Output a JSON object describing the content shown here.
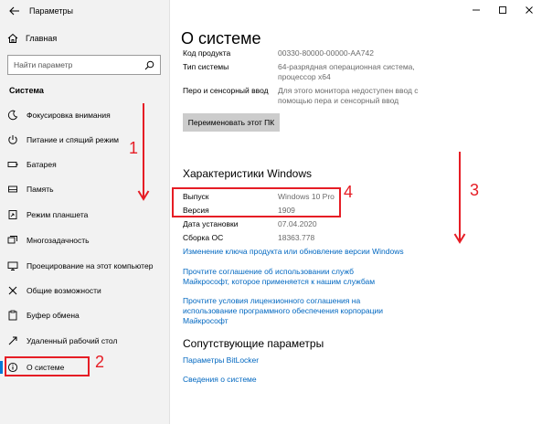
{
  "window": {
    "title": "Параметры"
  },
  "sidebar": {
    "home_label": "Главная",
    "search_placeholder": "Найти параметр",
    "section_title": "Система",
    "items": [
      {
        "label": "Фокусировка внимания",
        "icon": "moon-icon"
      },
      {
        "label": "Питание и спящий режим",
        "icon": "power-icon"
      },
      {
        "label": "Батарея",
        "icon": "battery-icon"
      },
      {
        "label": "Память",
        "icon": "storage-icon"
      },
      {
        "label": "Режим планшета",
        "icon": "tablet-icon"
      },
      {
        "label": "Многозадачность",
        "icon": "multitasking-icon"
      },
      {
        "label": "Проецирование на этот компьютер",
        "icon": "projection-icon"
      },
      {
        "label": "Общие возможности",
        "icon": "shared-icon"
      },
      {
        "label": "Буфер обмена",
        "icon": "clipboard-icon"
      },
      {
        "label": "Удаленный рабочий стол",
        "icon": "remote-icon"
      },
      {
        "label": "О системе",
        "icon": "info-icon",
        "active": true
      }
    ]
  },
  "main": {
    "page_title": "О системе",
    "device_specs": [
      {
        "label": "Код продукта",
        "value": "00330-80000-00000-AA742"
      },
      {
        "label": "Тип системы",
        "value": "64-разрядная операционная система, процессор x64"
      },
      {
        "label": "Перо и сенсорный ввод",
        "value": "Для этого монитора недоступен ввод с помощью пера и сенсорный ввод"
      }
    ],
    "rename_button": "Переименовать этот ПК",
    "windows_specs_title": "Характеристики Windows",
    "windows_specs": [
      {
        "label": "Выпуск",
        "value": "Windows 10 Pro"
      },
      {
        "label": "Версия",
        "value": "1909"
      },
      {
        "label": "Дата установки",
        "value": "07.04.2020"
      },
      {
        "label": "Сборка ОС",
        "value": "18363.778"
      }
    ],
    "links": [
      "Изменение ключа продукта или обновление версии Windows",
      "Прочтите соглашение об использовании служб Майкрософт, которое применяется к нашим службам",
      "Прочтите условия лицензионного соглашения на использование программного обеспечения корпорации Майкрософт"
    ],
    "related_title": "Сопутствующие параметры",
    "related_links": [
      "Параметры BitLocker",
      "Сведения о системе"
    ]
  },
  "annotations": [
    "1",
    "2",
    "3",
    "4"
  ],
  "colors": {
    "accent": "#0078d7",
    "link": "#0067c0",
    "annotation": "#e61d25",
    "sidebar_bg": "#f2f2f2"
  }
}
